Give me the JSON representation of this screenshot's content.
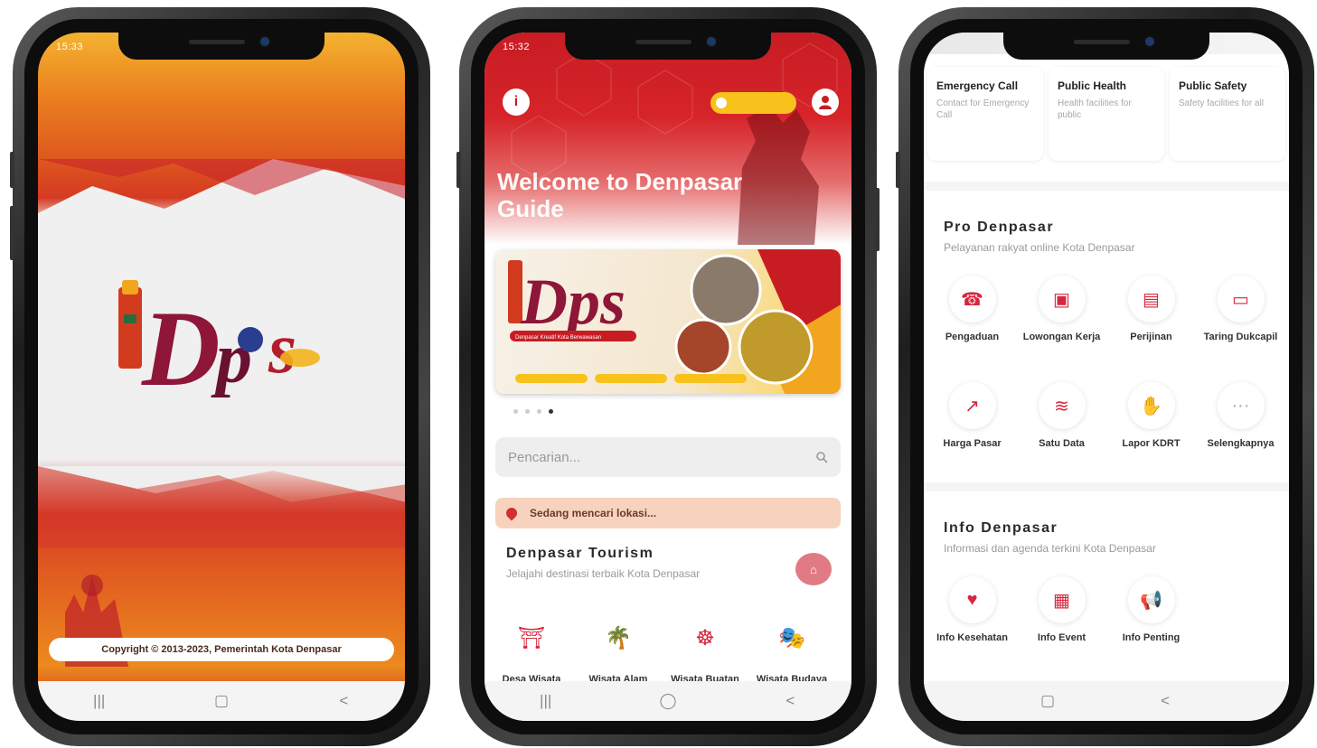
{
  "splash": {
    "status_time": "15:33",
    "logo_text": "Dps",
    "copyright": "Copyright © 2013-2023, Pemerintah Kota Denpasar"
  },
  "home": {
    "status_time": "15:32",
    "info_icon": "i",
    "welcome": "Welcome to Denpasar Guide",
    "banner_logo": "Dps",
    "banner_tagline": "Denpasar Kreatif Kota Berwawasan",
    "search_placeholder": "Pencarian...",
    "location_text": "Sedang mencari lokasi...",
    "tourism": {
      "title": "Denpasar Tourism",
      "subtitle": "Jelajahi destinasi terbaik Kota Denpasar"
    },
    "categories": [
      {
        "label": "Desa Wisata",
        "icon": "temple-icon"
      },
      {
        "label": "Wisata Alam",
        "icon": "palm-tree-icon"
      },
      {
        "label": "Wisata Buatan",
        "icon": "ferris-wheel-icon"
      },
      {
        "label": "Wisata Budaya",
        "icon": "mask-icon"
      }
    ]
  },
  "services": {
    "top_cards": [
      {
        "title": "Emergency Call",
        "desc": "Contact for Emergency Call"
      },
      {
        "title": "Public Health",
        "desc": "Health facilities for public"
      },
      {
        "title": "Public Safety",
        "desc": "Safety facilities for all"
      }
    ],
    "pro": {
      "title": "Pro Denpasar",
      "subtitle": "Pelayanan rakyat online Kota Denpasar",
      "items": [
        {
          "label": "Pengaduan",
          "icon": "headset-icon"
        },
        {
          "label": "Lowongan Kerja",
          "icon": "briefcase-icon"
        },
        {
          "label": "Perijinan",
          "icon": "document-icon"
        },
        {
          "label": "Taring Dukcapil",
          "icon": "id-card-icon"
        },
        {
          "label": "Harga Pasar",
          "icon": "price-chart-icon"
        },
        {
          "label": "Satu Data",
          "icon": "data-icon"
        },
        {
          "label": "Lapor KDRT",
          "icon": "report-icon"
        },
        {
          "label": "Selengkapnya",
          "icon": "more-icon"
        }
      ]
    },
    "info": {
      "title": "Info Denpasar",
      "subtitle": "Informasi dan agenda terkini Kota Denpasar",
      "items": [
        {
          "label": "Info Kesehatan",
          "icon": "heart-icon"
        },
        {
          "label": "Info Event",
          "icon": "calendar-icon"
        },
        {
          "label": "Info Penting",
          "icon": "megaphone-icon"
        }
      ]
    }
  },
  "colors": {
    "primary": "#c81c23",
    "accent": "#f7c21b"
  }
}
